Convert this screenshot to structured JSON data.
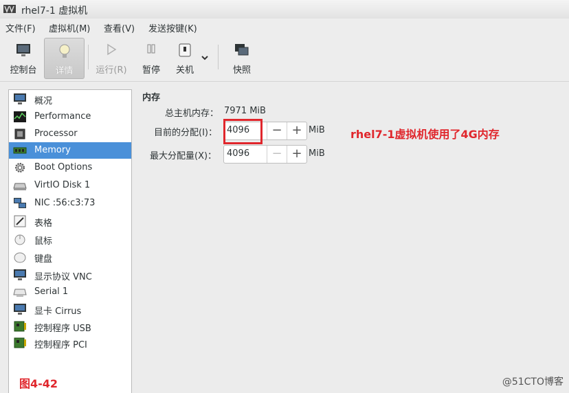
{
  "window": {
    "title": "rhel7-1 虚拟机"
  },
  "menubar": {
    "items": [
      "文件(F)",
      "虚拟机(M)",
      "查看(V)",
      "发送按键(K)"
    ]
  },
  "toolbar": {
    "console": "控制台",
    "details": "详情",
    "run": "运行(R)",
    "pause": "暂停",
    "shutdown": "关机",
    "snapshot": "快照"
  },
  "sidebar": {
    "items": [
      {
        "label": "概况",
        "icon": "overview-icon"
      },
      {
        "label": "Performance",
        "icon": "performance-icon"
      },
      {
        "label": "Processor",
        "icon": "processor-icon"
      },
      {
        "label": "Memory",
        "icon": "memory-icon",
        "selected": true
      },
      {
        "label": "Boot Options",
        "icon": "gear-icon"
      },
      {
        "label": "VirtIO Disk 1",
        "icon": "disk-icon"
      },
      {
        "label": "NIC :56:c3:73",
        "icon": "network-icon"
      },
      {
        "label": "表格",
        "icon": "tablet-icon"
      },
      {
        "label": "鼠标",
        "icon": "mouse-icon"
      },
      {
        "label": "键盘",
        "icon": "keyboard-icon"
      },
      {
        "label": "显示协议 VNC",
        "icon": "display-icon"
      },
      {
        "label": "Serial 1",
        "icon": "serial-icon"
      },
      {
        "label": "显卡 Cirrus",
        "icon": "video-icon"
      },
      {
        "label": "控制程序 USB",
        "icon": "controller-icon"
      },
      {
        "label": "控制程序 PCI",
        "icon": "controller-icon"
      }
    ]
  },
  "memory": {
    "section_title": "内存",
    "host_label": "总主机内存：",
    "host_value": "7971 MiB",
    "current_label": "目前的分配(I)：",
    "current_value": "4096",
    "max_label": "最大分配量(X)：",
    "max_value": "4096",
    "unit": "MiB",
    "minus": "−",
    "plus": "+"
  },
  "annotation": "rhel7-1虚拟机使用了4G内存",
  "figure_label": "图4-42",
  "watermark": "@51CTO博客",
  "colors": {
    "accent": "#4a90d9",
    "annotation": "#e0262c"
  }
}
